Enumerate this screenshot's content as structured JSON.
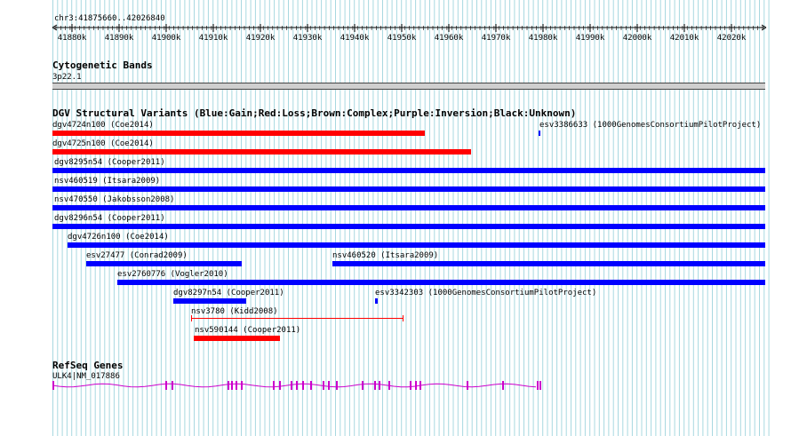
{
  "coordinate": "chr3:41875660..42026840",
  "ruler": {
    "ticks": [
      "41880k",
      "41890k",
      "41900k",
      "41910k",
      "41920k",
      "41930k",
      "41940k",
      "41950k",
      "41960k",
      "41970k",
      "41980k",
      "41990k",
      "42000k",
      "42010k",
      "42020k"
    ]
  },
  "cytobands": {
    "title": "Cytogenetic Bands",
    "band": "3p22.1"
  },
  "dgv": {
    "title": "DGV Structural Variants (Blue:Gain;Red:Loss;Brown:Complex;Purple:Inversion;Black:Unknown)",
    "features": [
      {
        "label": "dgv4724n100 (Coe2014)",
        "color": "#ff0000",
        "style": "bar"
      },
      {
        "label": "esv3386633 (1000GenomesConsortiumPilotProject)",
        "color": "#0000ff",
        "style": "tick"
      },
      {
        "label": "dgv4725n100 (Coe2014)",
        "color": "#ff0000",
        "style": "bar"
      },
      {
        "label": "dgv8295n54 (Cooper2011)",
        "color": "#0000ff",
        "style": "bar"
      },
      {
        "label": "nsv460519 (Itsara2009)",
        "color": "#0000ff",
        "style": "bar"
      },
      {
        "label": "nsv470550 (Jakobsson2008)",
        "color": "#0000ff",
        "style": "bar"
      },
      {
        "label": "dgv8296n54 (Cooper2011)",
        "color": "#0000ff",
        "style": "bar"
      },
      {
        "label": "dgv4726n100 (Coe2014)",
        "color": "#0000ff",
        "style": "bar"
      },
      {
        "label": "esv27477 (Conrad2009)",
        "color": "#0000ff",
        "style": "bar"
      },
      {
        "label": "nsv460520 (Itsara2009)",
        "color": "#0000ff",
        "style": "bar"
      },
      {
        "label": "esv2760776 (Vogler2010)",
        "color": "#0000ff",
        "style": "bar"
      },
      {
        "label": "dgv8297n54 (Cooper2011)",
        "color": "#0000ff",
        "style": "bar"
      },
      {
        "label": "esv3342303 (1000GenomesConsortiumPilotProject)",
        "color": "#0000ff",
        "style": "tick"
      },
      {
        "label": "nsv3780 (Kidd2008)",
        "color": "#ff0000",
        "style": "line"
      },
      {
        "label": "nsv590144 (Cooper2011)",
        "color": "#ff0000",
        "style": "bar"
      }
    ]
  },
  "refseq": {
    "title": "RefSeq Genes",
    "gene": "ULK4|NM_017886",
    "color": "#cc00cc"
  },
  "colors": {
    "grid": "#a8d8e0",
    "gain": "#0000ff",
    "loss": "#ff0000",
    "gene": "#cc00cc"
  }
}
